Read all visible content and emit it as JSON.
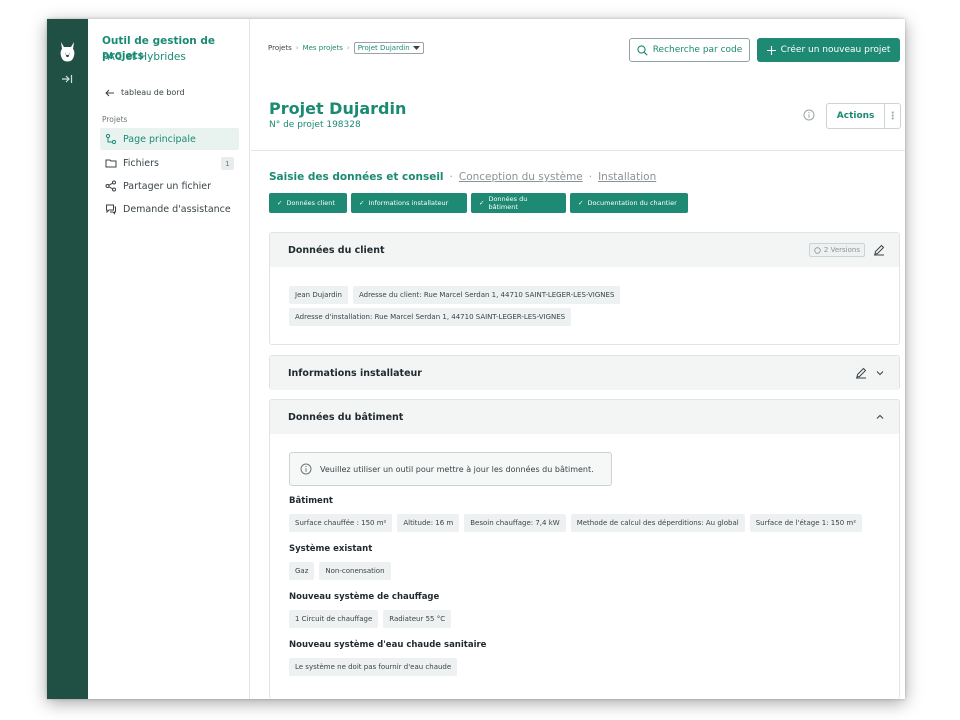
{
  "app": {
    "title": "Outil de gestion de projets",
    "subtitle": "PAC et Hybrides"
  },
  "sidebar": {
    "back_label": "tableau de bord",
    "section_label": "Projets",
    "items": [
      {
        "label": "Page principale",
        "icon": "flow-icon",
        "active": true
      },
      {
        "label": "Fichiers",
        "icon": "folder-icon",
        "badge": "1"
      },
      {
        "label": "Partager un fichier",
        "icon": "share-icon"
      },
      {
        "label": "Demande d'assistance",
        "icon": "chat-icon"
      }
    ]
  },
  "breadcrumb": {
    "items": [
      "Projets",
      "Mes projets"
    ],
    "current": "Projet Dujardin"
  },
  "header": {
    "search_label": "Recherche par code",
    "create_label": "Créer un nouveau projet"
  },
  "project": {
    "title": "Projet Dujardin",
    "number": "N° de projet 198328",
    "actions_label": "Actions"
  },
  "steps": {
    "current": "Saisie des données et conseil",
    "others": [
      "Conception du système",
      "Installation"
    ]
  },
  "chips": [
    "Données client",
    "Informations installateur",
    "Données du bâtiment",
    "Documentation du chantier"
  ],
  "client_panel": {
    "title": "Données du client",
    "versions_label": "2 Versions",
    "row1": [
      "Jean Dujardin",
      "Adresse du client: Rue Marcel Serdan 1, 44710 SAINT-LEGER-LES-VIGNES"
    ],
    "row2": [
      "Adresse d'installation: Rue Marcel Serdan 1, 44710 SAINT-LEGER-LES-VIGNES"
    ]
  },
  "installer_panel": {
    "title": "Informations installateur"
  },
  "building_panel": {
    "title": "Données du bâtiment",
    "notice": "Veuillez utiliser un outil pour mettre à jour les données du bâtiment.",
    "sections": [
      {
        "label": "Bâtiment",
        "tags": [
          "Surface chauffée : 150 m²",
          "Altitude: 16 m",
          "Besoin chauffage: 7,4 kW",
          "Methode de calcul des déperditions: Au global",
          "Surface de l'étage 1: 150 m²"
        ]
      },
      {
        "label": "Système existant",
        "tags": [
          "Gaz",
          "Non-conensation"
        ]
      },
      {
        "label": "Nouveau système de chauffage",
        "tags": [
          "1 Circuit de chauffage",
          "Radiateur 55 °C"
        ]
      },
      {
        "label": "Nouveau système d'eau chaude sanitaire",
        "tags": [
          "Le système ne doit pas fournir d'eau chaude"
        ]
      }
    ]
  },
  "colors": {
    "brand": "#1f8a73",
    "rail": "#1f5043"
  }
}
